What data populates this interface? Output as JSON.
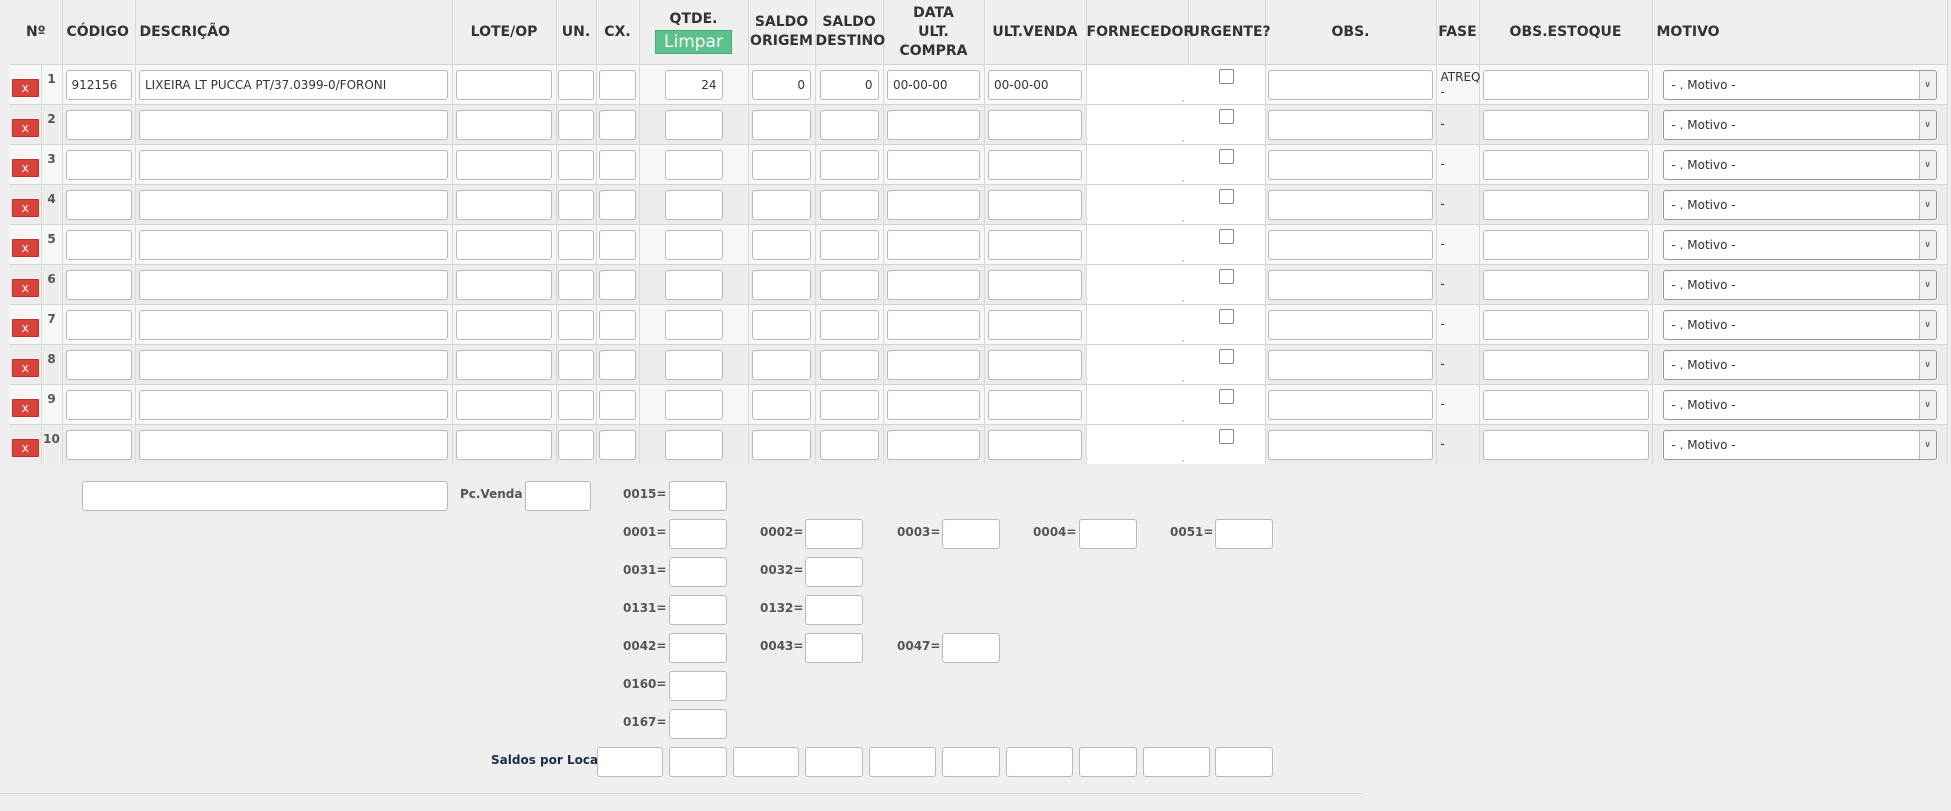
{
  "headers": {
    "no": "Nº",
    "codigo": "CÓDIGO",
    "descricao": "DESCRIÇÃO",
    "lote": "LOTE/OP",
    "un": "UN.",
    "cx": "CX.",
    "qtde": "QTDE.",
    "limpar": "Limpar",
    "saldo_origem": [
      "SALDO",
      "ORIGEM"
    ],
    "saldo_destino": [
      "SALDO",
      "DESTINO"
    ],
    "data_ult_compra": [
      "DATA",
      "ULT.",
      "COMPRA"
    ],
    "ult_venda": "ULT.VENDA",
    "fornecedor": "FORNECEDOR",
    "urgente": "URGENTE?",
    "obs": "OBS.",
    "fase": "FASE",
    "obs_estoque": "OBS.ESTOQUE",
    "motivo": "MOTIVO"
  },
  "delete_label": "x",
  "motivo_placeholder": "- . Motivo -",
  "rows": [
    {
      "n": "1",
      "codigo": "912156",
      "descricao": "LIXEIRA LT PUCCA PT/37.0399-0/FORONI",
      "qtde": "24",
      "saldo_origem": "0",
      "saldo_destino": "0",
      "data": "00-00-00",
      "ult_venda": "00-00-00",
      "fase": "ATREQ -"
    },
    {
      "n": "2",
      "codigo": "",
      "descricao": "",
      "qtde": "",
      "saldo_origem": "",
      "saldo_destino": "",
      "data": "",
      "ult_venda": "",
      "fase": "-"
    },
    {
      "n": "3",
      "codigo": "",
      "descricao": "",
      "qtde": "",
      "saldo_origem": "",
      "saldo_destino": "",
      "data": "",
      "ult_venda": "",
      "fase": "-"
    },
    {
      "n": "4",
      "codigo": "",
      "descricao": "",
      "qtde": "",
      "saldo_origem": "",
      "saldo_destino": "",
      "data": "",
      "ult_venda": "",
      "fase": "-"
    },
    {
      "n": "5",
      "codigo": "",
      "descricao": "",
      "qtde": "",
      "saldo_origem": "",
      "saldo_destino": "",
      "data": "",
      "ult_venda": "",
      "fase": "-"
    },
    {
      "n": "6",
      "codigo": "",
      "descricao": "",
      "qtde": "",
      "saldo_origem": "",
      "saldo_destino": "",
      "data": "",
      "ult_venda": "",
      "fase": "-"
    },
    {
      "n": "7",
      "codigo": "",
      "descricao": "",
      "qtde": "",
      "saldo_origem": "",
      "saldo_destino": "",
      "data": "",
      "ult_venda": "",
      "fase": "-"
    },
    {
      "n": "8",
      "codigo": "",
      "descricao": "",
      "qtde": "",
      "saldo_origem": "",
      "saldo_destino": "",
      "data": "",
      "ult_venda": "",
      "fase": "-"
    },
    {
      "n": "9",
      "codigo": "",
      "descricao": "",
      "qtde": "",
      "saldo_origem": "",
      "saldo_destino": "",
      "data": "",
      "ult_venda": "",
      "fase": "-"
    },
    {
      "n": "10",
      "codigo": "",
      "descricao": "",
      "qtde": "",
      "saldo_origem": "",
      "saldo_destino": "",
      "data": "",
      "ult_venda": "",
      "fase": "-"
    }
  ],
  "footer": {
    "pc_venda": "Pc.Venda",
    "l0015": "0015=",
    "l0001": "0001=",
    "l0002": "0002=",
    "l0003": "0003=",
    "l0004": "0004=",
    "l0051": "0051=",
    "l0031": "0031=",
    "l0032": "0032=",
    "l0131": "0131=",
    "l0132": "0132=",
    "l0042": "0042=",
    "l0043": "0043=",
    "l0047": "0047=",
    "l0160": "0160=",
    "l0167": "0167=",
    "saldos_por_local": "Saldos por Local"
  }
}
